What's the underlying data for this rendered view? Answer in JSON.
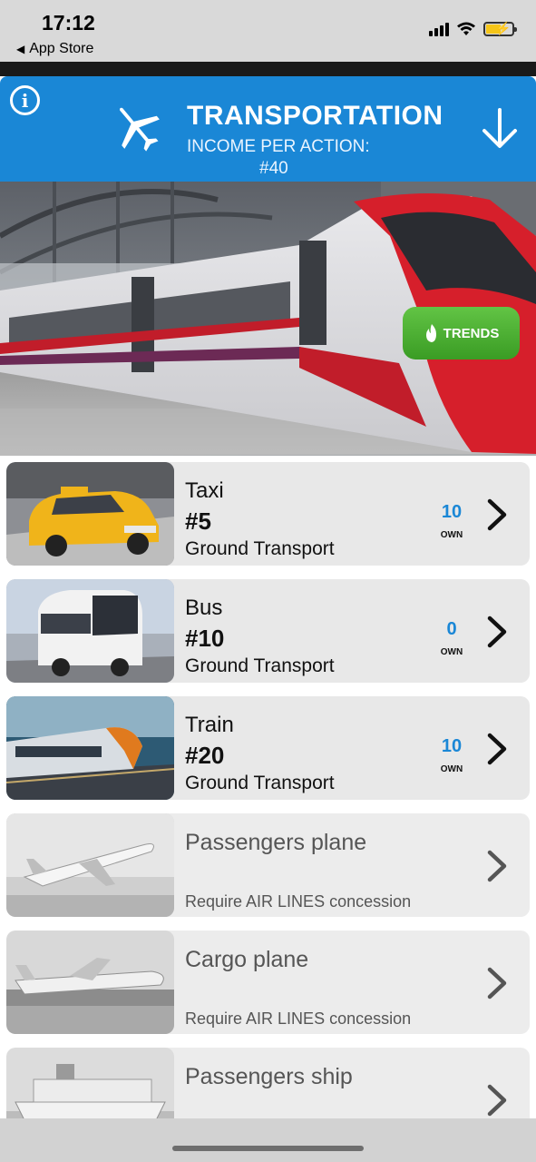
{
  "status_bar": {
    "time": "17:12",
    "back_label": "App Store"
  },
  "header": {
    "title": "TRANSPORTATION",
    "income_label": "INCOME PER ACTION:",
    "income_value": "#40",
    "color": "#1a87d6"
  },
  "hero": {
    "trends_label": "TRENDS",
    "trends_color": "#4caf35"
  },
  "items": [
    {
      "name": "Taxi",
      "price": "#5",
      "category": "Ground Transport",
      "own_count": "10",
      "own_label": "OWN",
      "locked": false
    },
    {
      "name": "Bus",
      "price": "#10",
      "category": "Ground Transport",
      "own_count": "0",
      "own_label": "OWN",
      "locked": false
    },
    {
      "name": "Train",
      "price": "#20",
      "category": "Ground Transport",
      "own_count": "10",
      "own_label": "OWN",
      "locked": false
    },
    {
      "name": "Passengers plane",
      "requirement": "Require AIR LINES concession",
      "locked": true
    },
    {
      "name": "Cargo plane",
      "requirement": "Require AIR LINES concession",
      "locked": true
    },
    {
      "name": "Passengers ship",
      "locked": true
    }
  ],
  "icons": [
    "info-icon",
    "airplane-icon",
    "down-arrow-icon",
    "flame-icon",
    "chevron-right-icon",
    "signal-icon",
    "wifi-icon",
    "battery-icon"
  ]
}
